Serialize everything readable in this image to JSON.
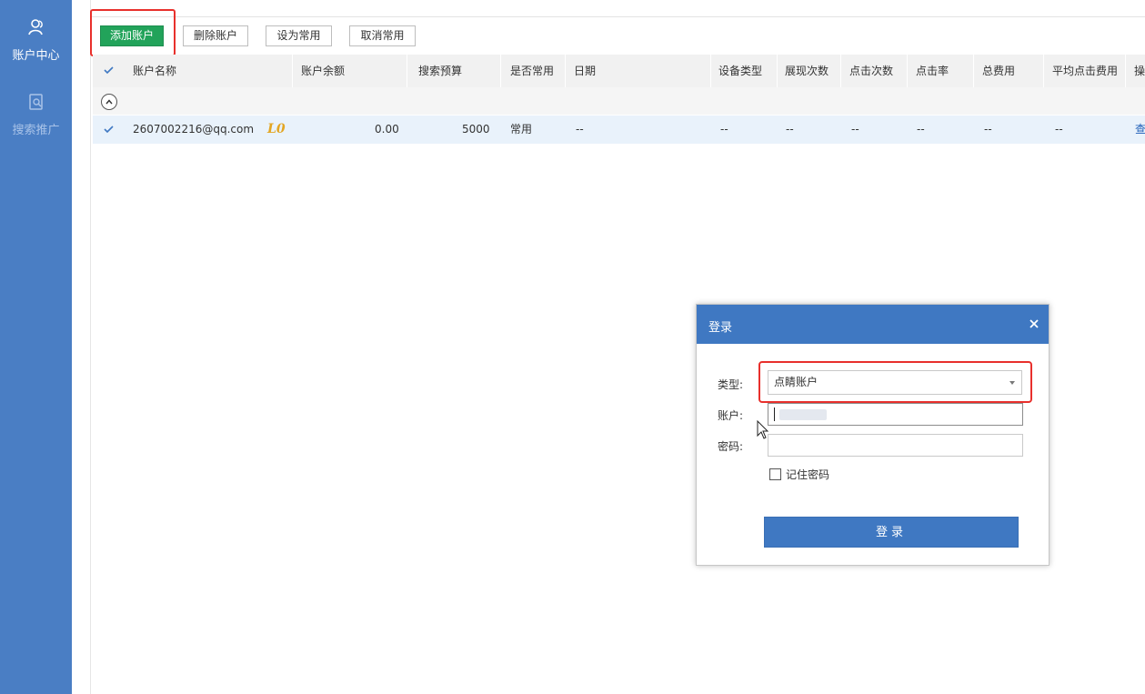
{
  "sidebar": {
    "items": [
      {
        "label": "账户中心",
        "icon": "account-center-icon",
        "active": true
      },
      {
        "label": "搜索推广",
        "icon": "search-promotion-icon",
        "active": false
      }
    ]
  },
  "toolbar": {
    "add_label": "添加账户",
    "delete_label": "删除账户",
    "set_common_label": "设为常用",
    "cancel_common_label": "取消常用"
  },
  "table": {
    "headers": [
      "账户名称",
      "账户余额",
      "搜索预算",
      "是否常用",
      "日期",
      "设备类型",
      "展现次数",
      "点击次数",
      "点击率",
      "总费用",
      "平均点击费用",
      "操"
    ],
    "rows": [
      {
        "account": "2607002216@qq.com",
        "level": "L0",
        "balance": "0.00",
        "budget": "5000",
        "common": "常用",
        "date": "--",
        "device": "--",
        "impressions": "--",
        "clicks": "--",
        "ctr": "--",
        "total_cost": "--",
        "avg_cpc": "--",
        "action": "查"
      }
    ]
  },
  "dialog": {
    "title": "登录",
    "type_label": "类型:",
    "type_value": "点睛账户",
    "account_label": "账户:",
    "password_label": "密码:",
    "remember_label": "记住密码",
    "login_label": "登录"
  },
  "colors": {
    "sidebar": "#4a7ec4",
    "primary": "#3f78c2",
    "add_button": "#22a35a",
    "highlight": "#e8302c",
    "level_badge": "#e3a623"
  }
}
